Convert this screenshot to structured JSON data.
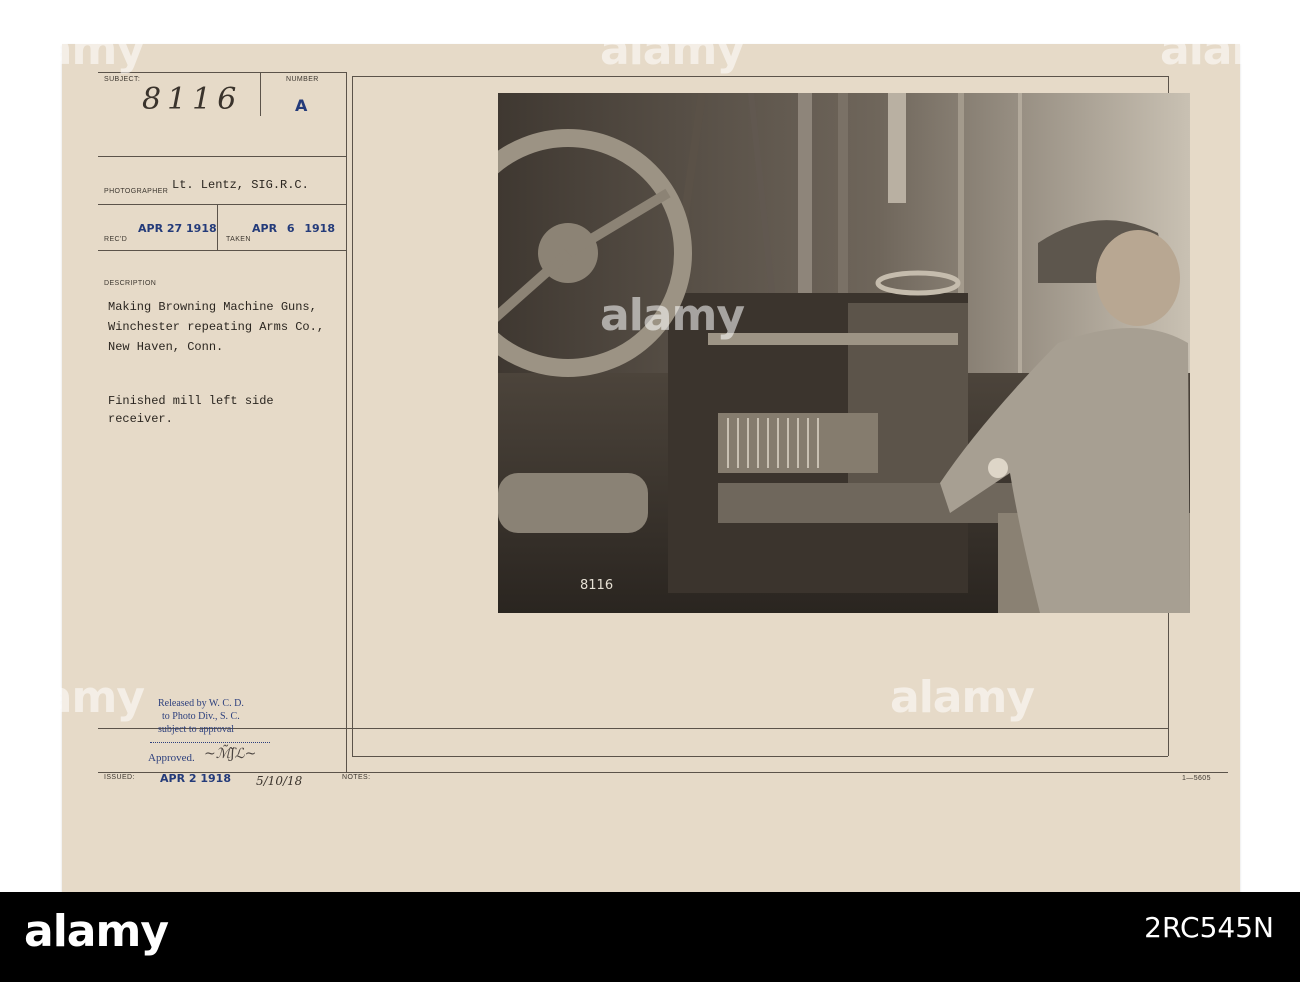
{
  "record": {
    "subject_label": "SUBJECT:",
    "subject_value": "8116",
    "number_label": "NUMBER",
    "number_value": "A",
    "photographer_label": "PHOTOGRAPHER",
    "photographer_value": "Lt. Lentz, SIG.R.C.",
    "recd_label": "REC'D",
    "recd_date": "APR 27 1918",
    "taken_label": "TAKEN",
    "taken_date": "APR 6 1918",
    "description_label": "DESCRIPTION",
    "description_lines": [
      "Making Browning Machine Guns,",
      "Winchester repeating Arms Co.,",
      "New Haven, Conn."
    ],
    "caption_lines": [
      "Finished mill left side",
      "receiver."
    ],
    "release_lines": [
      "Released by W. C. D.",
      "to Photo Div., S. C.",
      "subject to approval"
    ],
    "approved_label": "Approved.",
    "issued_label": "ISSUED:",
    "issued_date": "APR 2 1918",
    "issued_hand": "5/10/18",
    "notes_label": "NOTES:",
    "form_code": "1—5605"
  },
  "photo": {
    "plate_mark": "8116"
  },
  "stock_watermark": {
    "brand": "alamy",
    "image_id": "2RC545N"
  },
  "colors": {
    "card": "#e6dac8",
    "stamp_blue": "#243b7a",
    "band": "#000000"
  }
}
